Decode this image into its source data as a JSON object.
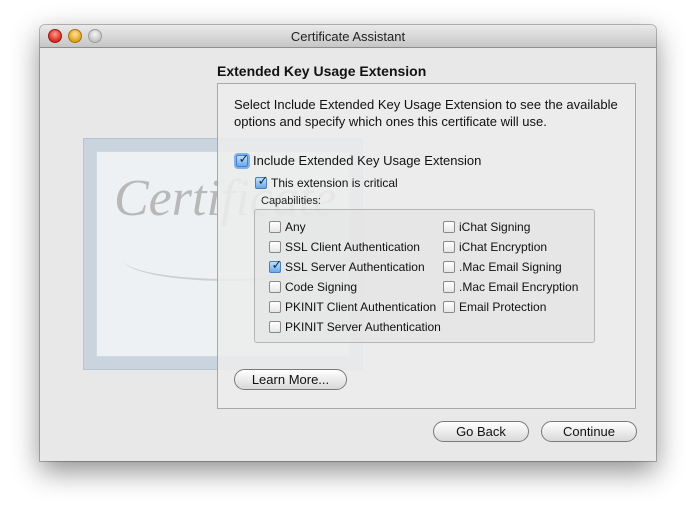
{
  "window": {
    "title": "Certificate Assistant"
  },
  "background": {
    "cert_word": "Certificate"
  },
  "heading": "Extended Key Usage Extension",
  "description": "Select Include Extended Key Usage Extension to see the available options and specify which ones this certificate will use.",
  "include_extension": {
    "label": "Include Extended Key Usage Extension",
    "checked": true
  },
  "critical": {
    "label": "This extension is critical",
    "checked": true
  },
  "capabilities": {
    "label": "Capabilities:",
    "left": [
      {
        "label": "Any",
        "checked": false
      },
      {
        "label": "SSL Client Authentication",
        "checked": false
      },
      {
        "label": "SSL Server Authentication",
        "checked": true
      },
      {
        "label": "Code Signing",
        "checked": false
      },
      {
        "label": "PKINIT Client Authentication",
        "checked": false
      },
      {
        "label": "PKINIT Server Authentication",
        "checked": false
      }
    ],
    "right": [
      {
        "label": "iChat Signing",
        "checked": false
      },
      {
        "label": "iChat Encryption",
        "checked": false
      },
      {
        "label": ".Mac Email Signing",
        "checked": false
      },
      {
        "label": ".Mac Email Encryption",
        "checked": false
      },
      {
        "label": "Email Protection",
        "checked": false
      }
    ]
  },
  "buttons": {
    "learn_more": "Learn More...",
    "go_back": "Go Back",
    "continue": "Continue"
  },
  "checkmark_glyph": "✓"
}
